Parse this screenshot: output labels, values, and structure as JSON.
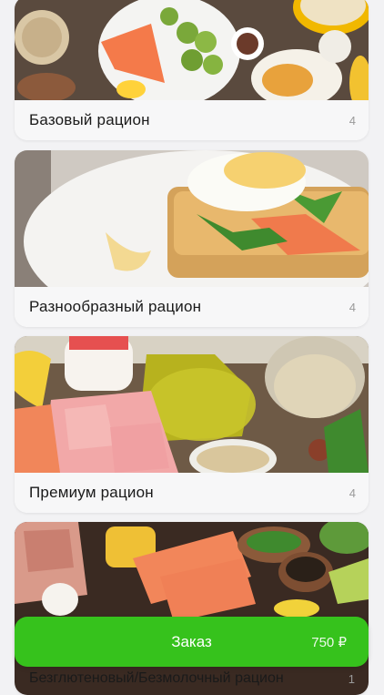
{
  "colors": {
    "accent": "#36c21c",
    "background": "#f2f2f4"
  },
  "rations": [
    {
      "title": "Базовый рацион",
      "count": "4"
    },
    {
      "title": "Разнообразный рацион",
      "count": "4"
    },
    {
      "title": "Премиум рацион",
      "count": "4"
    },
    {
      "title": "Безглютеновый/Безмолочный рацион",
      "count": "1"
    }
  ],
  "order": {
    "label": "Заказ",
    "price": "750 ₽"
  }
}
